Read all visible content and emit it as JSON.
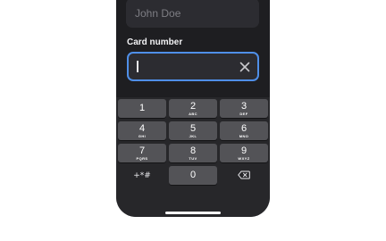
{
  "form": {
    "name_placeholder": "John Doe",
    "card_label": "Card number",
    "card_value": ""
  },
  "keypad": {
    "keys": [
      {
        "digit": "1",
        "letters": ""
      },
      {
        "digit": "2",
        "letters": "ABC"
      },
      {
        "digit": "3",
        "letters": "DEF"
      },
      {
        "digit": "4",
        "letters": "GHI"
      },
      {
        "digit": "5",
        "letters": "JKL"
      },
      {
        "digit": "6",
        "letters": "MNO"
      },
      {
        "digit": "7",
        "letters": "PQRS"
      },
      {
        "digit": "8",
        "letters": "TUV"
      },
      {
        "digit": "9",
        "letters": "WXYZ"
      },
      {
        "digit": "0",
        "letters": ""
      }
    ],
    "symbols_label": "+*#"
  },
  "colors": {
    "accent": "#4f8fe8",
    "background": "#1e1e21",
    "key": "#535357"
  }
}
